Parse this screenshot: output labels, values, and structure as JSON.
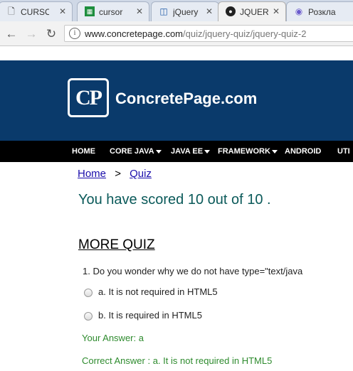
{
  "tabs": [
    {
      "icon": "document-icon",
      "title": "CURSO"
    },
    {
      "icon": "sheets-icon",
      "title": "cursor"
    },
    {
      "icon": "jquery-icon",
      "title": "jQuery"
    },
    {
      "icon": "github-icon",
      "title": "JQUER"
    },
    {
      "icon": "globe-icon",
      "title": "Розкла"
    }
  ],
  "address": {
    "domain": "www.concretepage.com",
    "path": "/quiz/jquery-quiz/jquery-quiz-2"
  },
  "site": {
    "logo_mark": "CP",
    "name": "ConcretePage.com"
  },
  "menu": [
    "HOME",
    "CORE JAVA",
    "JAVA EE",
    "FRAMEWORK",
    "ANDROID",
    "UTI"
  ],
  "breadcrumb": {
    "home": "Home",
    "sep": ">",
    "quiz": "Quiz"
  },
  "score_text": "You have scored 10 out of 10 .",
  "more_quiz": "MORE QUIZ",
  "question": "1. Do you wonder why we do not have type=\"text/java",
  "options": [
    "a. It is not required in HTML5",
    "b. It is required in HTML5"
  ],
  "your_answer": "Your Answer: a",
  "correct_answer": "Correct Answer : a. It is not required in HTML5",
  "colors": {
    "banner": "#0a3a6b",
    "score": "#0b5a5a",
    "answer": "#2e8b2e"
  }
}
